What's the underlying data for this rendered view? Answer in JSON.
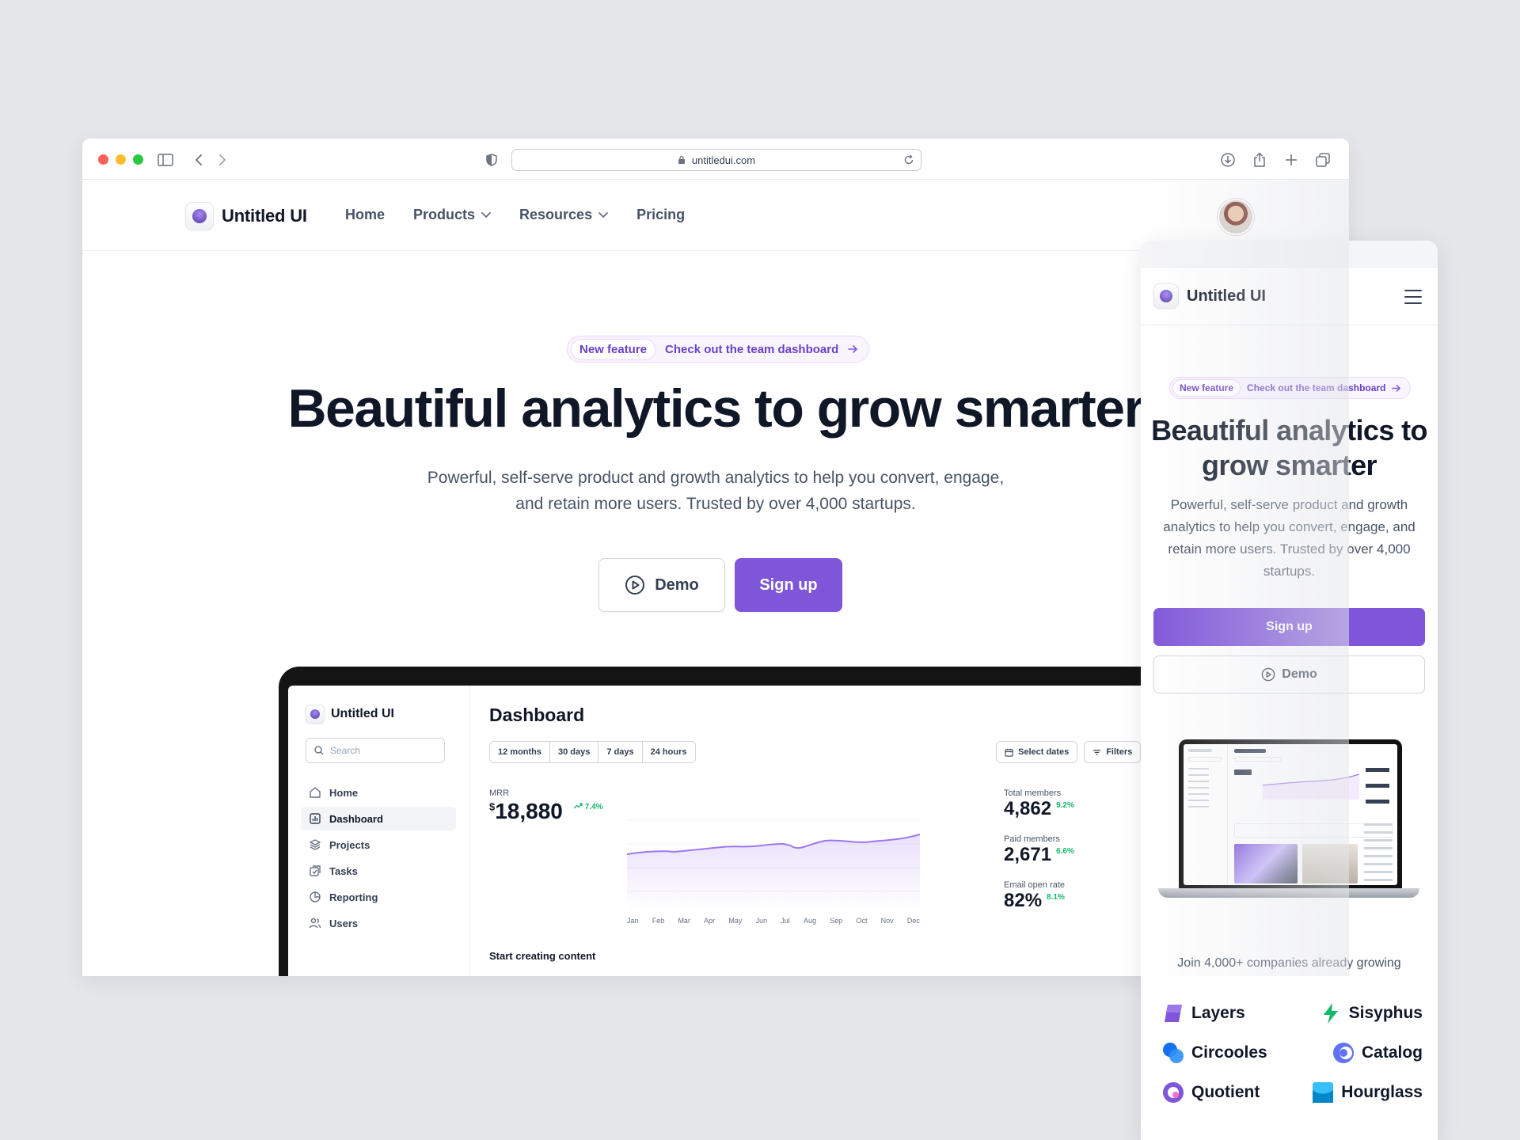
{
  "browser": {
    "url": "untitledui.com",
    "traffic_light_colors": [
      "#ff5f57",
      "#febc2e",
      "#28c840"
    ]
  },
  "brand": {
    "name": "Untitled UI",
    "accent": "#7f56d9",
    "accent_text": "#6941c6"
  },
  "nav": {
    "items": [
      {
        "label": "Home",
        "has_dropdown": false
      },
      {
        "label": "Products",
        "has_dropdown": true
      },
      {
        "label": "Resources",
        "has_dropdown": true
      },
      {
        "label": "Pricing",
        "has_dropdown": false
      }
    ]
  },
  "hero": {
    "badge_pill": "New feature",
    "badge_text": "Check out the team dashboard",
    "title": "Beautiful analytics to grow smarter",
    "subtitle_line1": "Powerful, self-serve product and growth analytics to help you convert, engage,",
    "subtitle_line2": "and retain more users. Trusted by over 4,000 startups.",
    "demo_label": "Demo",
    "signup_label": "Sign up"
  },
  "dashboard": {
    "brand": "Untitled UI",
    "search_placeholder": "Search",
    "sidebar": [
      {
        "label": "Home",
        "icon": "home-icon",
        "active": false
      },
      {
        "label": "Dashboard",
        "icon": "bar-chart-icon",
        "active": true
      },
      {
        "label": "Projects",
        "icon": "layers-icon",
        "active": false
      },
      {
        "label": "Tasks",
        "icon": "check-square-icon",
        "active": false
      },
      {
        "label": "Reporting",
        "icon": "pie-chart-icon",
        "active": false
      },
      {
        "label": "Users",
        "icon": "users-icon",
        "active": false
      }
    ],
    "title": "Dashboard",
    "ranges": [
      "12 months",
      "30 days",
      "7 days",
      "24 hours"
    ],
    "select_dates": "Select dates",
    "filters": "Filters",
    "mrr_label": "MRR",
    "mrr_currency": "$",
    "mrr_value": "18,880",
    "mrr_delta": "7.4%",
    "months": [
      "Jan",
      "Feb",
      "Mar",
      "Apr",
      "May",
      "Jun",
      "Jul",
      "Aug",
      "Sep",
      "Oct",
      "Nov",
      "Dec"
    ],
    "stats": [
      {
        "label": "Total members",
        "value": "4,862",
        "delta": "9.2%"
      },
      {
        "label": "Paid members",
        "value": "2,671",
        "delta": "6.6%"
      },
      {
        "label": "Email open rate",
        "value": "82%",
        "delta": "8.1%"
      }
    ],
    "section_title": "Start creating content"
  },
  "mobile": {
    "brand": "Untitled UI",
    "badge_pill": "New feature",
    "badge_text": "Check out the team dashboard",
    "title": "Beautiful analytics to grow smarter",
    "subtitle": "Powerful, self-serve product and growth analytics to help you convert, engage, and retain more users. Trusted by over 4,000 startups.",
    "signup_label": "Sign up",
    "demo_label": "Demo",
    "join_text": "Join 4,000+ companies already growing",
    "companies": [
      {
        "name": "Layers",
        "icon": "layers-logo-icon",
        "color": "#7f56d9"
      },
      {
        "name": "Sisyphus",
        "icon": "sisyphus-logo-icon",
        "color": "#12b76a"
      },
      {
        "name": "Circooles",
        "icon": "circooles-logo-icon",
        "color": "#1570ef"
      },
      {
        "name": "Catalog",
        "icon": "catalog-logo-icon",
        "color": "#6172f3"
      },
      {
        "name": "Quotient",
        "icon": "quotient-logo-icon",
        "color": "#9e77ed"
      },
      {
        "name": "Hourglass",
        "icon": "hourglass-logo-icon",
        "color": "#0ba5ec"
      }
    ]
  }
}
